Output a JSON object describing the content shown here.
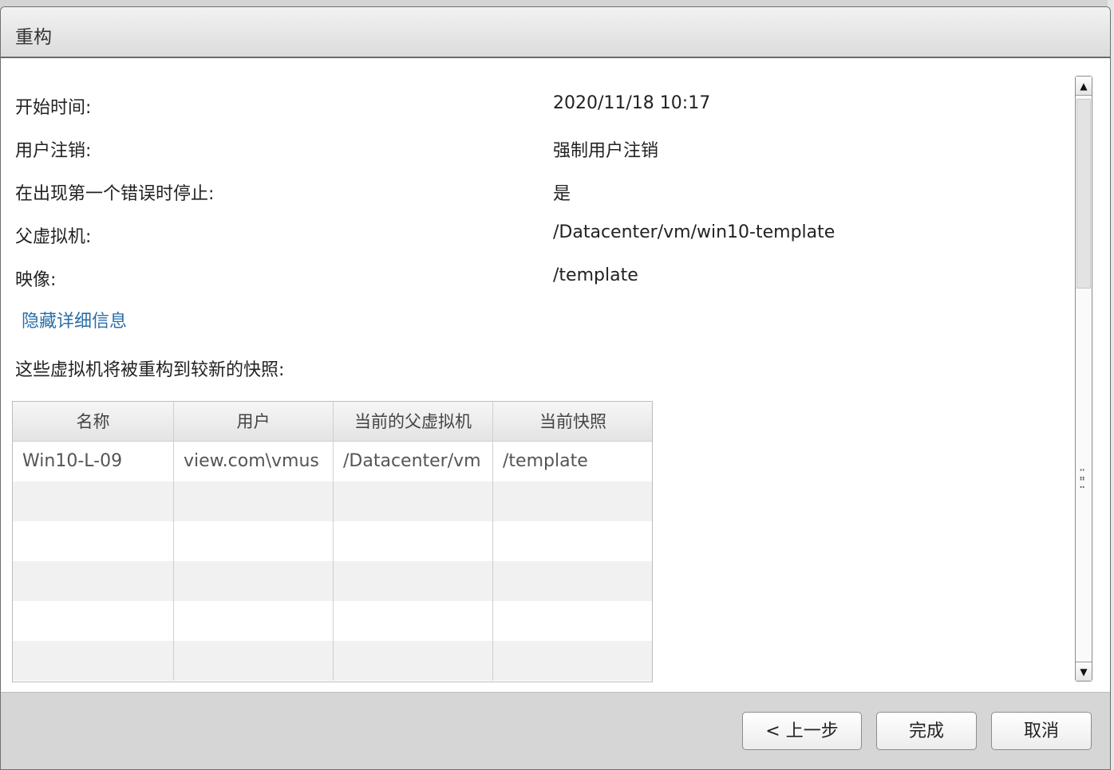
{
  "dialog": {
    "title": "重构"
  },
  "fields": [
    {
      "label": "开始时间:",
      "value": "2020/11/18 10:17"
    },
    {
      "label": "用户注销:",
      "value": "强制用户注销"
    },
    {
      "label": "在出现第一个错误时停止:",
      "value": "是"
    },
    {
      "label": "父虚拟机:",
      "value": "/Datacenter/vm/win10-template"
    },
    {
      "label": "映像:",
      "value": "/template"
    }
  ],
  "details_link": "隐藏详细信息",
  "table": {
    "caption": "这些虚拟机将被重构到较新的快照:",
    "columns": [
      "名称",
      "用户",
      "当前的父虚拟机",
      "当前快照"
    ],
    "rows": [
      [
        "Win10-L-09",
        "view.com\\vmus",
        "/Datacenter/vm",
        "/template"
      ]
    ]
  },
  "scrollbar": {
    "up_icon": "triangle-up-icon",
    "down_icon": "triangle-down-icon"
  },
  "buttons": {
    "back": "< 上一步",
    "finish": "完成",
    "cancel": "取消"
  }
}
